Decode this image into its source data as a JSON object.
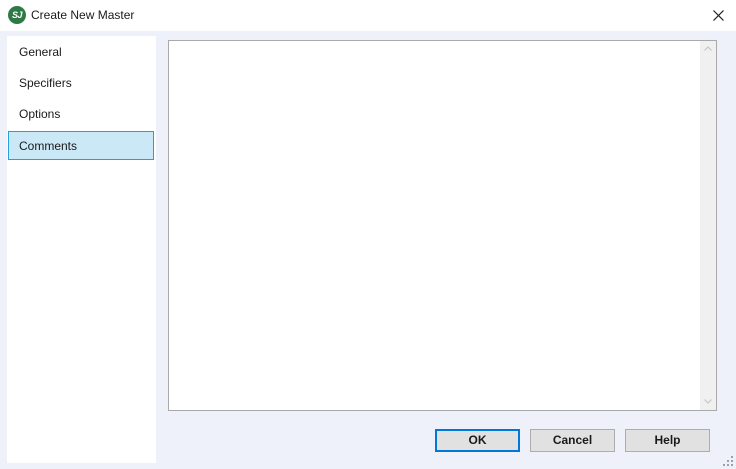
{
  "window": {
    "title": "Create New Master",
    "app_icon_text": "SJ",
    "close_icon": "close-icon"
  },
  "sidebar": {
    "items": [
      {
        "label": "General",
        "selected": false
      },
      {
        "label": "Specifiers",
        "selected": false
      },
      {
        "label": "Options",
        "selected": false
      },
      {
        "label": "Comments",
        "selected": true
      }
    ]
  },
  "comments": {
    "value": ""
  },
  "buttons": {
    "ok": "OK",
    "cancel": "Cancel",
    "help": "Help"
  },
  "colors": {
    "selection_fill": "#cbe8f6",
    "selection_border": "#26a0da",
    "default_button_border": "#0078d7",
    "dialog_background": "#eef1fa"
  }
}
